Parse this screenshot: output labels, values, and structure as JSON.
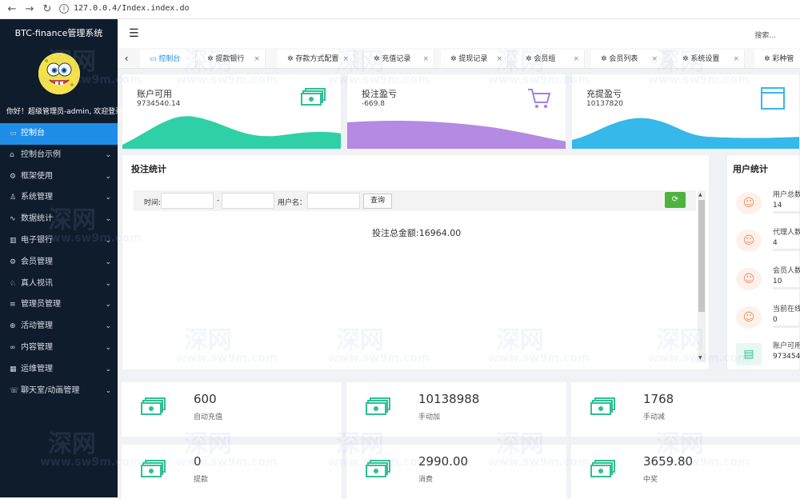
{
  "browser": {
    "url": "127.0.0.4/Index.index.do"
  },
  "app": {
    "title": "BTC-finance管理系统",
    "welcome": "你好！超级管理员-admin, 欢迎登录"
  },
  "sidebar": {
    "items": [
      {
        "label": "控制台",
        "icon": "monitor-icon",
        "active": true
      },
      {
        "label": "控制台示例",
        "icon": "home-icon"
      },
      {
        "label": "框架使用",
        "icon": "chip-icon"
      },
      {
        "label": "系统管理",
        "icon": "user-icon"
      },
      {
        "label": "数据统计",
        "icon": "pulse-icon"
      },
      {
        "label": "电子银行",
        "icon": "bank-icon"
      },
      {
        "label": "会员管理",
        "icon": "gear-icon"
      },
      {
        "label": "真人视讯",
        "icon": "people-icon"
      },
      {
        "label": "管理员管理",
        "icon": "list-icon"
      },
      {
        "label": "活动管理",
        "icon": "plus-circle-icon"
      },
      {
        "label": "内容管理",
        "icon": "link-icon"
      },
      {
        "label": "运维管理",
        "icon": "grid-icon"
      },
      {
        "label": "聊天室/动画管理",
        "icon": "chat-icon"
      }
    ]
  },
  "topbar": {
    "search_label": "搜索..."
  },
  "tabs": [
    {
      "label": "控制台",
      "active": true
    },
    {
      "label": "提款银行"
    },
    {
      "label": "存款方式配置"
    },
    {
      "label": "充值记录"
    },
    {
      "label": "提现记录"
    },
    {
      "label": "会员组"
    },
    {
      "label": "会员列表"
    },
    {
      "label": "系统设置"
    },
    {
      "label": "彩种管"
    }
  ],
  "stats": [
    {
      "title": "账户可用",
      "value": "9734540.14",
      "color": "#2fd0a6",
      "icon": "cash-icon"
    },
    {
      "title": "投注盈亏",
      "value": "-669.8",
      "color": "#b48ae3",
      "icon": "cart-icon"
    },
    {
      "title": "充提盈亏",
      "value": "10137820",
      "color": "#36b8ea",
      "icon": "window-icon"
    }
  ],
  "bet_panel": {
    "title": "投注统计",
    "time_label": "时间:",
    "dash": "-",
    "user_label": "用户名：",
    "query_button": "查询",
    "total_text": "投注总金额:16964.00"
  },
  "user_panel": {
    "title": "用户统计",
    "rows": [
      {
        "label": "用户总数",
        "value": "14"
      },
      {
        "label": "代理人数",
        "value": "4"
      },
      {
        "label": "会员人数",
        "value": "10"
      },
      {
        "label": "当前在线",
        "value": "0"
      },
      {
        "label": "账户可用",
        "value": "9734540."
      }
    ]
  },
  "bottom_cards": [
    {
      "value": "600",
      "label": "自动充值"
    },
    {
      "value": "10138988",
      "label": "手动加"
    },
    {
      "value": "1768",
      "label": "手动减"
    },
    {
      "value": "0",
      "label": "提款"
    },
    {
      "value": "2990.00",
      "label": "消费"
    },
    {
      "value": "3659.80",
      "label": "中奖"
    }
  ],
  "watermark": {
    "text1": "深网",
    "text2": "www.sw9m.com"
  }
}
